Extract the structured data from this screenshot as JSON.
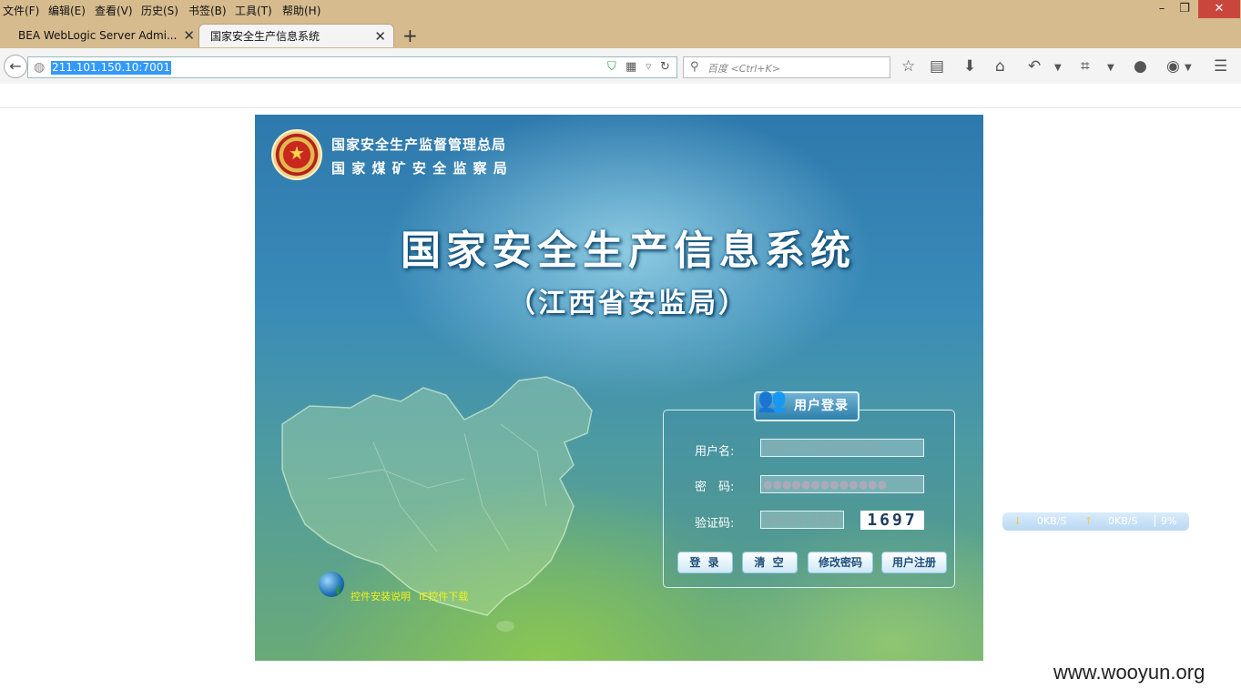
{
  "menubar": {
    "items": [
      "文件(F)",
      "编辑(E)",
      "查看(V)",
      "历史(S)",
      "书签(B)",
      "工具(T)",
      "帮助(H)"
    ]
  },
  "window_controls": {
    "minimize": "–",
    "restore": "❐",
    "close": "✕"
  },
  "tabs": [
    {
      "title": "BEA WebLogic Server Admi...",
      "active": false
    },
    {
      "title": "国家安全生产信息系统",
      "active": true
    }
  ],
  "new_tab": "+",
  "navbar": {
    "url": "211.101.150.10:7001",
    "search_placeholder": "百度 <Ctrl+K>"
  },
  "banner": {
    "org_line1": "国家安全生产监督管理总局",
    "org_line2": "国 家 煤 矿 安 全 监 察 局",
    "title": "国家安全生产信息系统",
    "subtitle": "（江西省安监局）"
  },
  "login": {
    "header": "用户登录",
    "username_label": "用户名:",
    "username_value": "请使用IE浏览器访问系统",
    "password_label": "密　码:",
    "password_value": "●●●●●●●●●●●●●",
    "captcha_label": "验证码:",
    "captcha_value": "请使用IE浏览器",
    "captcha_code": "1697",
    "buttons": {
      "login": "登 录",
      "clear": "清 空",
      "change_password": "修改密码",
      "register": "用户注册"
    }
  },
  "downloads": {
    "install_guide": "控件安装说明",
    "ie_download": "IE控件下载"
  },
  "speed_widget": {
    "down": "0KB/S",
    "up": "0KB/S",
    "cpu": "9%"
  },
  "watermark": "www.wooyun.org",
  "colors": {
    "chrome": "#d6bb8e",
    "banner_blue": "#2e79ad",
    "banner_green": "#8cc850",
    "link_yellow": "#f1f21a"
  }
}
